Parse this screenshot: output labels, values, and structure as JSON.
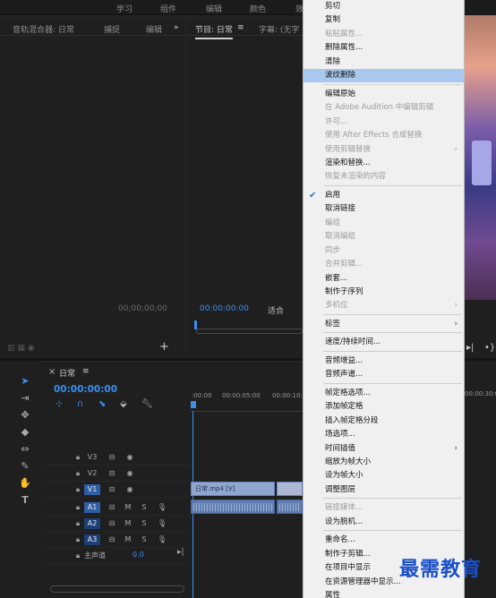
{
  "workspace_tabs": [
    "学习",
    "组件",
    "编辑",
    "颜色",
    "效"
  ],
  "audio_panel": {
    "tabs": [
      "音轨混合器: 日常",
      "捕捉",
      "编辑"
    ],
    "overflow": "»",
    "timecode": "00;00;00;00",
    "add_button": "+"
  },
  "program_panel": {
    "tabs": [
      "节目: 日常",
      "字幕: (无字"
    ],
    "menu_glyph": "≡",
    "timecode": "00:00:00:00",
    "fit_label": "适合"
  },
  "timeline": {
    "close_glyph": "×",
    "sequence_name": "日常",
    "menu_glyph": "≡",
    "timecode": "00:00:00:00",
    "ruler_labels": [
      ":00:00",
      "00:00:05:00",
      "00:00:10:00",
      "00:00:30:00"
    ],
    "tracks": [
      {
        "name": "V3",
        "toggle": ""
      },
      {
        "name": "V2",
        "toggle": ""
      },
      {
        "name": "V1",
        "toggle": "V1"
      },
      {
        "name": "A1",
        "toggle": "A1",
        "m": "M",
        "s": "S"
      },
      {
        "name": "A2",
        "toggle": "",
        "m": "M",
        "s": "S"
      },
      {
        "name": "A3",
        "toggle": "",
        "m": "M",
        "s": "S"
      }
    ],
    "master_label": "主声道",
    "master_value": "0.0",
    "clip_name": "日常.mp4 [V]"
  },
  "context_menu": {
    "items": [
      {
        "label": "剪切",
        "disabled": false
      },
      {
        "label": "复制",
        "disabled": false
      },
      {
        "label": "粘贴属性...",
        "disabled": true
      },
      {
        "label": "删除属性...",
        "disabled": false
      },
      {
        "label": "清除",
        "disabled": false
      },
      {
        "label": "波纹删除",
        "disabled": false,
        "highlight": true
      },
      {
        "sep": true
      },
      {
        "label": "编辑原始",
        "disabled": false
      },
      {
        "label": "在 Adobe Audition 中编辑剪辑",
        "disabled": true
      },
      {
        "label": "许可...",
        "disabled": true
      },
      {
        "label": "使用 After Effects 合成替换",
        "disabled": true
      },
      {
        "label": "使用剪辑替换",
        "disabled": true,
        "submenu": true
      },
      {
        "label": "渲染和替换...",
        "disabled": false
      },
      {
        "label": "恢复未渲染的内容",
        "disabled": true
      },
      {
        "sep": true
      },
      {
        "label": "启用",
        "disabled": false,
        "checked": true
      },
      {
        "label": "取消链接",
        "disabled": false
      },
      {
        "label": "编组",
        "disabled": true
      },
      {
        "label": "取消编组",
        "disabled": true
      },
      {
        "label": "同步",
        "disabled": true
      },
      {
        "label": "合并剪辑...",
        "disabled": true
      },
      {
        "label": "嵌套...",
        "disabled": false
      },
      {
        "label": "制作子序列",
        "disabled": false
      },
      {
        "label": "多机位",
        "disabled": true,
        "submenu": true
      },
      {
        "sep": true
      },
      {
        "label": "标签",
        "disabled": false,
        "submenu": true
      },
      {
        "sep": true
      },
      {
        "label": "速度/持续时间...",
        "disabled": false
      },
      {
        "sep": true
      },
      {
        "label": "音频增益...",
        "disabled": false
      },
      {
        "label": "音频声道...",
        "disabled": false
      },
      {
        "sep": true
      },
      {
        "label": "帧定格选项...",
        "disabled": false
      },
      {
        "label": "添加帧定格",
        "disabled": false
      },
      {
        "label": "插入帧定格分段",
        "disabled": false
      },
      {
        "label": "场选项...",
        "disabled": false
      },
      {
        "label": "时间插值",
        "disabled": false,
        "submenu": true
      },
      {
        "label": "缩放为帧大小",
        "disabled": false
      },
      {
        "label": "设为帧大小",
        "disabled": false
      },
      {
        "label": "调整图层",
        "disabled": false
      },
      {
        "sep": true
      },
      {
        "label": "链接媒体...",
        "disabled": true
      },
      {
        "label": "设为脱机...",
        "disabled": false
      },
      {
        "sep": true
      },
      {
        "label": "重命名...",
        "disabled": false
      },
      {
        "label": "制作子剪辑...",
        "disabled": false
      },
      {
        "label": "在项目中显示",
        "disabled": false
      },
      {
        "label": "在资源管理器中显示...",
        "disabled": false
      },
      {
        "label": "属性",
        "disabled": false
      }
    ]
  },
  "watermark": "最需教育",
  "colors": {
    "accent": "#3a8ff0",
    "menu_bg": "#f0f0f0",
    "menu_highlight": "#a9c8ee",
    "panel_bg": "#1f1f1f"
  }
}
